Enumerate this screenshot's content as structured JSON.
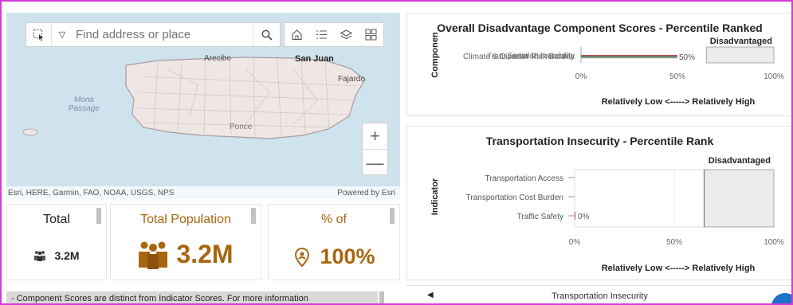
{
  "map": {
    "search_placeholder": "Find address or place",
    "labels": {
      "arecibo": "Arecibo",
      "san_juan": "San Juan",
      "fajardo": "Fajardo",
      "mona_passage_1": "Mona",
      "mona_passage_2": "Passage",
      "ponce": "Ponce"
    },
    "zoom_in": "+",
    "zoom_out": "—",
    "attribution": "Esri, HERE, Garmin, FAO, NOAA, USGS, NPS",
    "powered_by": "Powered by Esri",
    "colors": {
      "water": "#cfe3ee",
      "land": "#efe7e3",
      "outline": "#a99aa3"
    }
  },
  "cards": [
    {
      "title": "Total",
      "value": "3.2M",
      "icon": "people-icon"
    },
    {
      "title": "Total Population",
      "value": "3.2M",
      "icon": "people-icon"
    },
    {
      "title": "% of",
      "value": "100%",
      "icon": "location-person-icon"
    }
  ],
  "note": "- Component Scores are distinct from Indicator Scores. For more information",
  "tabbar": {
    "label": "Transportation Insecurity",
    "prev": "◀",
    "next": "▶"
  },
  "colors": {
    "accent": "#a8660e",
    "frame": "#d63ad6",
    "disadvantaged_shade": "#ebebeb"
  },
  "chart_data": [
    {
      "type": "bar",
      "title": "Overall Disadvantage Component Scores - Percentile Ranked",
      "ylabel": "Componen",
      "xlabel": "Relatively Low <-----> Relatively High",
      "categories": [
        "Climate & Disaster Risk Burden",
        "Transportation Insecurity",
        "Social Vulnerability"
      ],
      "series": [
        {
          "values": [
            50,
            50,
            50
          ]
        }
      ],
      "data_label": "50%",
      "xlim": [
        0,
        100
      ],
      "xticks": [
        "0%",
        "50%",
        "100%"
      ],
      "threshold": 65,
      "threshold_label": "Disadvantaged",
      "bar_colors": [
        "#c44b4b",
        "#3a8f5b",
        "#9a9a9a"
      ]
    },
    {
      "type": "bar",
      "title": "Transportation Insecurity - Percentile Rank",
      "ylabel": "Indicator",
      "xlabel": "Relatively Low <-----> Relatively High",
      "categories": [
        "Transportation Access",
        "Transportation Cost Burden",
        "Traffic Safety"
      ],
      "series": [
        {
          "values": [
            null,
            null,
            0
          ]
        }
      ],
      "data_label": "0%",
      "xlim": [
        0,
        100
      ],
      "xticks": [
        "0%",
        "50%",
        "100%"
      ],
      "threshold": 65,
      "threshold_label": "Disadvantaged"
    }
  ]
}
